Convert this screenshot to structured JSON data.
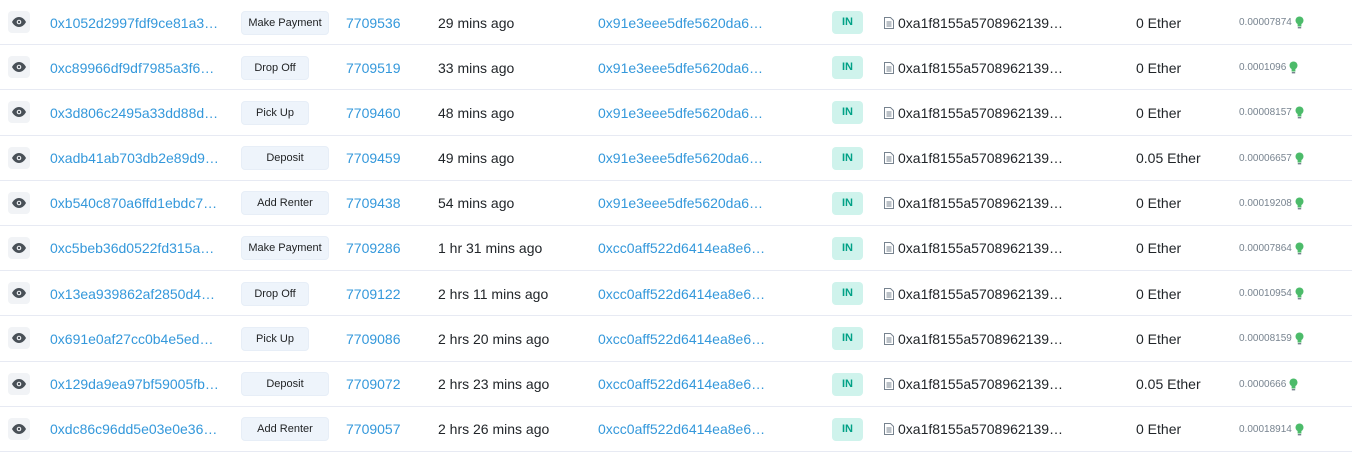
{
  "icons": {
    "view": "eye-icon",
    "contract": "document-icon",
    "fee": "lightbulb-icon"
  },
  "colors": {
    "link": "#3498db",
    "in_badge_bg": "#cff3ec",
    "in_badge_text": "#00a186",
    "fee_bulb": "#4cbb6a"
  },
  "columns": [
    "view",
    "txn_hash",
    "method",
    "block",
    "age",
    "from",
    "direction",
    "to",
    "value",
    "txn_fee"
  ],
  "rows": [
    {
      "hash": "0x1052d2997fdf9ce81a3…",
      "method": "Make Payment",
      "block": "7709536",
      "age": "29 mins ago",
      "from": "0x91e3eee5dfe5620da6…",
      "dir": "IN",
      "to": "0xa1f8155a5708962139…",
      "value": "0 Ether",
      "fee": "0.00007874"
    },
    {
      "hash": "0xc89966df9df7985a3f6…",
      "method": "Drop Off",
      "block": "7709519",
      "age": "33 mins ago",
      "from": "0x91e3eee5dfe5620da6…",
      "dir": "IN",
      "to": "0xa1f8155a5708962139…",
      "value": "0 Ether",
      "fee": "0.0001096"
    },
    {
      "hash": "0x3d806c2495a33dd88d…",
      "method": "Pick Up",
      "block": "7709460",
      "age": "48 mins ago",
      "from": "0x91e3eee5dfe5620da6…",
      "dir": "IN",
      "to": "0xa1f8155a5708962139…",
      "value": "0 Ether",
      "fee": "0.00008157"
    },
    {
      "hash": "0xadb41ab703db2e89d9…",
      "method": "Deposit",
      "block": "7709459",
      "age": "49 mins ago",
      "from": "0x91e3eee5dfe5620da6…",
      "dir": "IN",
      "to": "0xa1f8155a5708962139…",
      "value": "0.05 Ether",
      "fee": "0.00006657"
    },
    {
      "hash": "0xb540c870a6ffd1ebdc7…",
      "method": "Add Renter",
      "block": "7709438",
      "age": "54 mins ago",
      "from": "0x91e3eee5dfe5620da6…",
      "dir": "IN",
      "to": "0xa1f8155a5708962139…",
      "value": "0 Ether",
      "fee": "0.00019208"
    },
    {
      "hash": "0xc5beb36d0522fd315a…",
      "method": "Make Payment",
      "block": "7709286",
      "age": "1 hr 31 mins ago",
      "from": "0xcc0aff522d6414ea8e6…",
      "dir": "IN",
      "to": "0xa1f8155a5708962139…",
      "value": "0 Ether",
      "fee": "0.00007864"
    },
    {
      "hash": "0x13ea939862af2850d4…",
      "method": "Drop Off",
      "block": "7709122",
      "age": "2 hrs 11 mins ago",
      "from": "0xcc0aff522d6414ea8e6…",
      "dir": "IN",
      "to": "0xa1f8155a5708962139…",
      "value": "0 Ether",
      "fee": "0.00010954"
    },
    {
      "hash": "0x691e0af27cc0b4e5ed…",
      "method": "Pick Up",
      "block": "7709086",
      "age": "2 hrs 20 mins ago",
      "from": "0xcc0aff522d6414ea8e6…",
      "dir": "IN",
      "to": "0xa1f8155a5708962139…",
      "value": "0 Ether",
      "fee": "0.00008159"
    },
    {
      "hash": "0x129da9ea97bf59005fb…",
      "method": "Deposit",
      "block": "7709072",
      "age": "2 hrs 23 mins ago",
      "from": "0xcc0aff522d6414ea8e6…",
      "dir": "IN",
      "to": "0xa1f8155a5708962139…",
      "value": "0.05 Ether",
      "fee": "0.0000666"
    },
    {
      "hash": "0xdc86c96dd5e03e0e36…",
      "method": "Add Renter",
      "block": "7709057",
      "age": "2 hrs 26 mins ago",
      "from": "0xcc0aff522d6414ea8e6…",
      "dir": "IN",
      "to": "0xa1f8155a5708962139…",
      "value": "0 Ether",
      "fee": "0.00018914"
    }
  ]
}
